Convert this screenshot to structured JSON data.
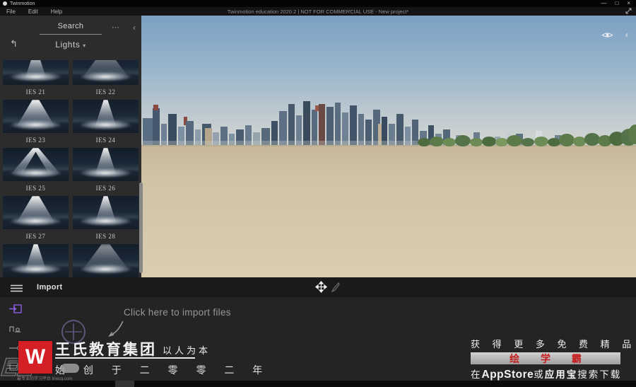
{
  "window": {
    "app_name": "Twinmotion",
    "doc_title": "Twinmotion education 2020.2 | NOT FOR COMMERCIAL USE - New project*",
    "menu": {
      "file": "File",
      "edit": "Edit",
      "help": "Help"
    },
    "controls": {
      "minimize": "—",
      "maximize": "□",
      "close": "×"
    }
  },
  "sidebar": {
    "search_placeholder": "Search",
    "more_glyph": "⋯",
    "collapse_glyph": "‹",
    "back_glyph": "↰",
    "category": "Lights",
    "caret_glyph": "▾",
    "lights": [
      {
        "label": "IES 21"
      },
      {
        "label": "IES 22"
      },
      {
        "label": "IES 23"
      },
      {
        "label": "IES 24"
      },
      {
        "label": "IES 25"
      },
      {
        "label": "IES 26"
      },
      {
        "label": "IES 27"
      },
      {
        "label": "IES 28"
      },
      {
        "label": ""
      },
      {
        "label": ""
      }
    ]
  },
  "viewport": {
    "collapse_glyph": "‹"
  },
  "toolbar": {
    "import_label": "Import"
  },
  "import_panel": {
    "hint": "Click here to import files"
  },
  "watermark_left": {
    "ghost": "EZ",
    "brand_letter": "W",
    "tagline": "最专业的学习平台 linecg.com",
    "company": "王氏教育集团",
    "motto": "以人为本",
    "founded": "始 创 于 二 零 零 二 年"
  },
  "watermark_right": {
    "line1": "获 得 更 多 免 费 精 品 教 程",
    "badge": "绘 学 霸",
    "line3_prefix": "在",
    "line3_store": "AppStore",
    "line3_or": "或",
    "line3_app": "应用宝",
    "line3_suffix": "搜索下载"
  },
  "colors": {
    "accent_purple": "#7b4fd0",
    "brand_red": "#d41f26",
    "badge_text_red": "#c41e1e",
    "sky_top": "#7ba0c2",
    "ground_sand": "#d2c5a8"
  }
}
